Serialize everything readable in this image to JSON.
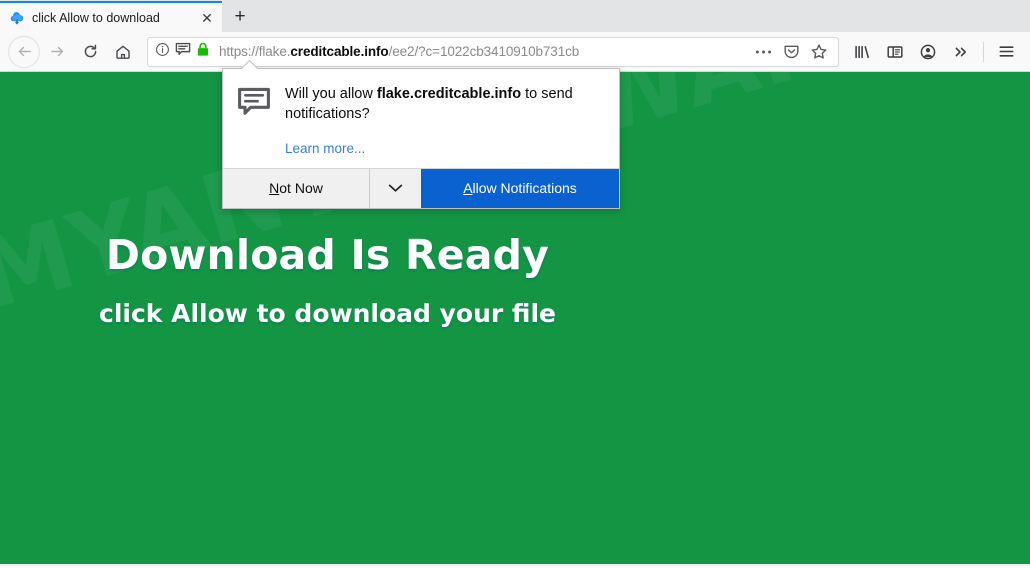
{
  "browser": {
    "tab": {
      "title": "click Allow to download",
      "favicon": "cloud-upload-icon",
      "close_label": "✕"
    },
    "new_tab_label": "+",
    "nav": {
      "back": "back-arrow-icon",
      "forward": "forward-arrow-icon",
      "reload": "reload-icon",
      "home": "home-icon"
    },
    "urlbar": {
      "identity_info": "info-icon",
      "notification_permission": "notification-bubble-icon",
      "lock": "padlock-icon",
      "url_prefix": "https://flake.",
      "url_domain": "creditcable.info",
      "url_suffix": "/ee2/?c=1022cb3410910b731cb",
      "page_actions": "•••",
      "pocket": "pocket-icon",
      "bookmark": "star-icon"
    },
    "toolbar_right": {
      "library": "library-icon",
      "sidebar": "sidebar-icon",
      "account": "account-icon",
      "overflow": "»",
      "menu": "hamburger-menu-icon"
    }
  },
  "popup": {
    "icon": "notification-bubble-icon",
    "question_before": "Will you allow ",
    "question_domain": "flake.creditcable.info",
    "question_after": " to send notifications?",
    "learn_more": "Learn more...",
    "not_now_underlined": "N",
    "not_now_rest": "ot Now",
    "dropdown": "chevron-down-icon",
    "allow_underlined": "A",
    "allow_rest": "llow Notifications"
  },
  "page": {
    "icon": "book-upload-icon",
    "headline": "Download Is Ready",
    "subline": "click Allow to download your file",
    "watermark": "MYANTISPYWARE.COM",
    "background_color": "#139544",
    "accent_blue": "#0a62d0"
  }
}
